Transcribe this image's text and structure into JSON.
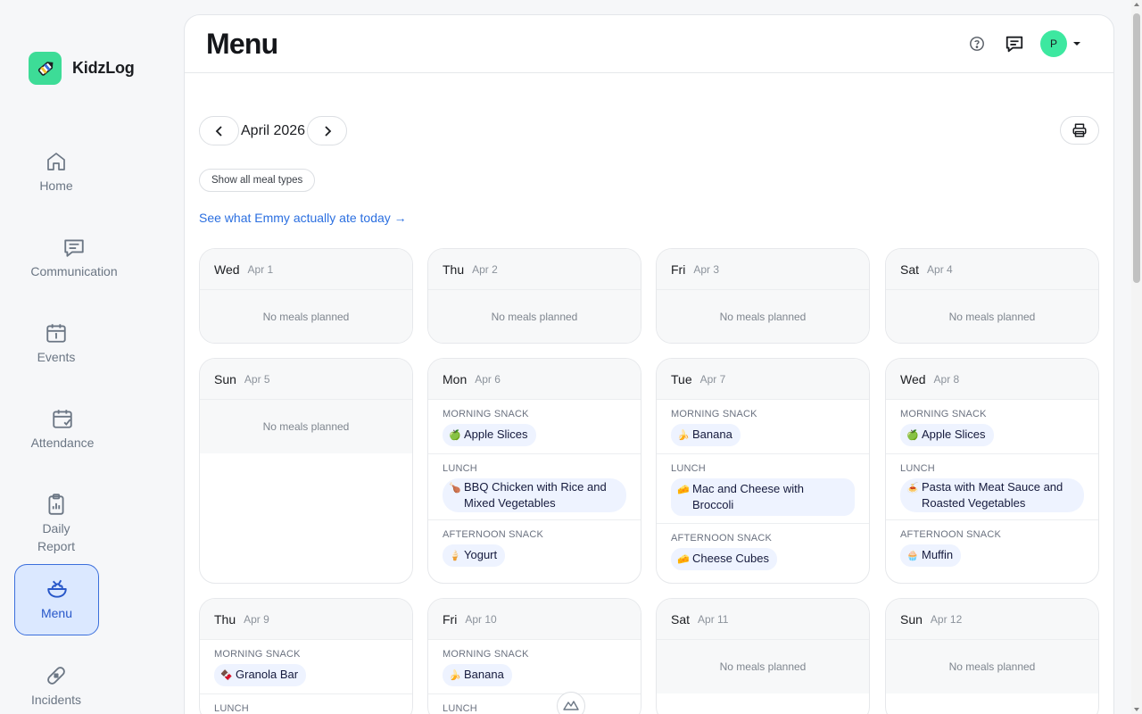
{
  "brand": {
    "name": "KidzLog",
    "logo_icon": "pencil-icon"
  },
  "nav": [
    {
      "label": "Home",
      "icon": "home-icon",
      "active": false
    },
    {
      "label": "Communication",
      "icon": "chat-icon",
      "active": false
    },
    {
      "label": "Events",
      "icon": "calendar-icon",
      "active": false
    },
    {
      "label": "Attendance",
      "icon": "calendar-check-icon",
      "active": false
    },
    {
      "label": "Daily Report",
      "icon": "clipboard-icon",
      "active": false
    },
    {
      "label": "Menu",
      "icon": "bowl-icon",
      "active": true
    },
    {
      "label": "Incidents",
      "icon": "bandage-icon",
      "active": false
    }
  ],
  "header": {
    "title": "Menu",
    "avatar_initial": "P"
  },
  "month": {
    "label": "April 2026"
  },
  "filter_chip": "Show all meal types",
  "link": "See what Emmy actually ate today →",
  "empty_text": "No meals planned",
  "days": [
    {
      "day": "Wed",
      "date": "Apr 1",
      "meals": []
    },
    {
      "day": "Thu",
      "date": "Apr 2",
      "meals": []
    },
    {
      "day": "Fri",
      "date": "Apr 3",
      "meals": []
    },
    {
      "day": "Sat",
      "date": "Apr 4",
      "meals": []
    },
    {
      "day": "Sun",
      "date": "Apr 5",
      "meals": []
    },
    {
      "day": "Mon",
      "date": "Apr 6",
      "meals": [
        {
          "type": "MORNING SNACK",
          "food": "Apple Slices",
          "icon": "🍏"
        },
        {
          "type": "LUNCH",
          "food": "BBQ Chicken with Rice and Mixed Vegetables",
          "icon": "🍗"
        },
        {
          "type": "AFTERNOON SNACK",
          "food": "Yogurt",
          "icon": "🍦"
        }
      ]
    },
    {
      "day": "Tue",
      "date": "Apr 7",
      "meals": [
        {
          "type": "MORNING SNACK",
          "food": "Banana",
          "icon": "🍌"
        },
        {
          "type": "LUNCH",
          "food": "Mac and Cheese with Broccoli",
          "icon": "🧀"
        },
        {
          "type": "AFTERNOON SNACK",
          "food": "Cheese Cubes",
          "icon": "🧀"
        }
      ]
    },
    {
      "day": "Wed",
      "date": "Apr 8",
      "meals": [
        {
          "type": "MORNING SNACK",
          "food": "Apple Slices",
          "icon": "🍏"
        },
        {
          "type": "LUNCH",
          "food": "Pasta with Meat Sauce and Roasted Vegetables",
          "icon": "🍝"
        },
        {
          "type": "AFTERNOON SNACK",
          "food": "Muffin",
          "icon": "🧁"
        }
      ]
    },
    {
      "day": "Thu",
      "date": "Apr 9",
      "meals": [
        {
          "type": "MORNING SNACK",
          "food": "Granola Bar",
          "icon": "🍫"
        },
        {
          "type": "LUNCH",
          "food": "",
          "icon": ""
        }
      ]
    },
    {
      "day": "Fri",
      "date": "Apr 10",
      "meals": [
        {
          "type": "MORNING SNACK",
          "food": "Banana",
          "icon": "🍌"
        },
        {
          "type": "LUNCH",
          "food": "",
          "icon": ""
        }
      ]
    },
    {
      "day": "Sat",
      "date": "Apr 11",
      "meals": []
    },
    {
      "day": "Sun",
      "date": "Apr 12",
      "meals": []
    }
  ]
}
